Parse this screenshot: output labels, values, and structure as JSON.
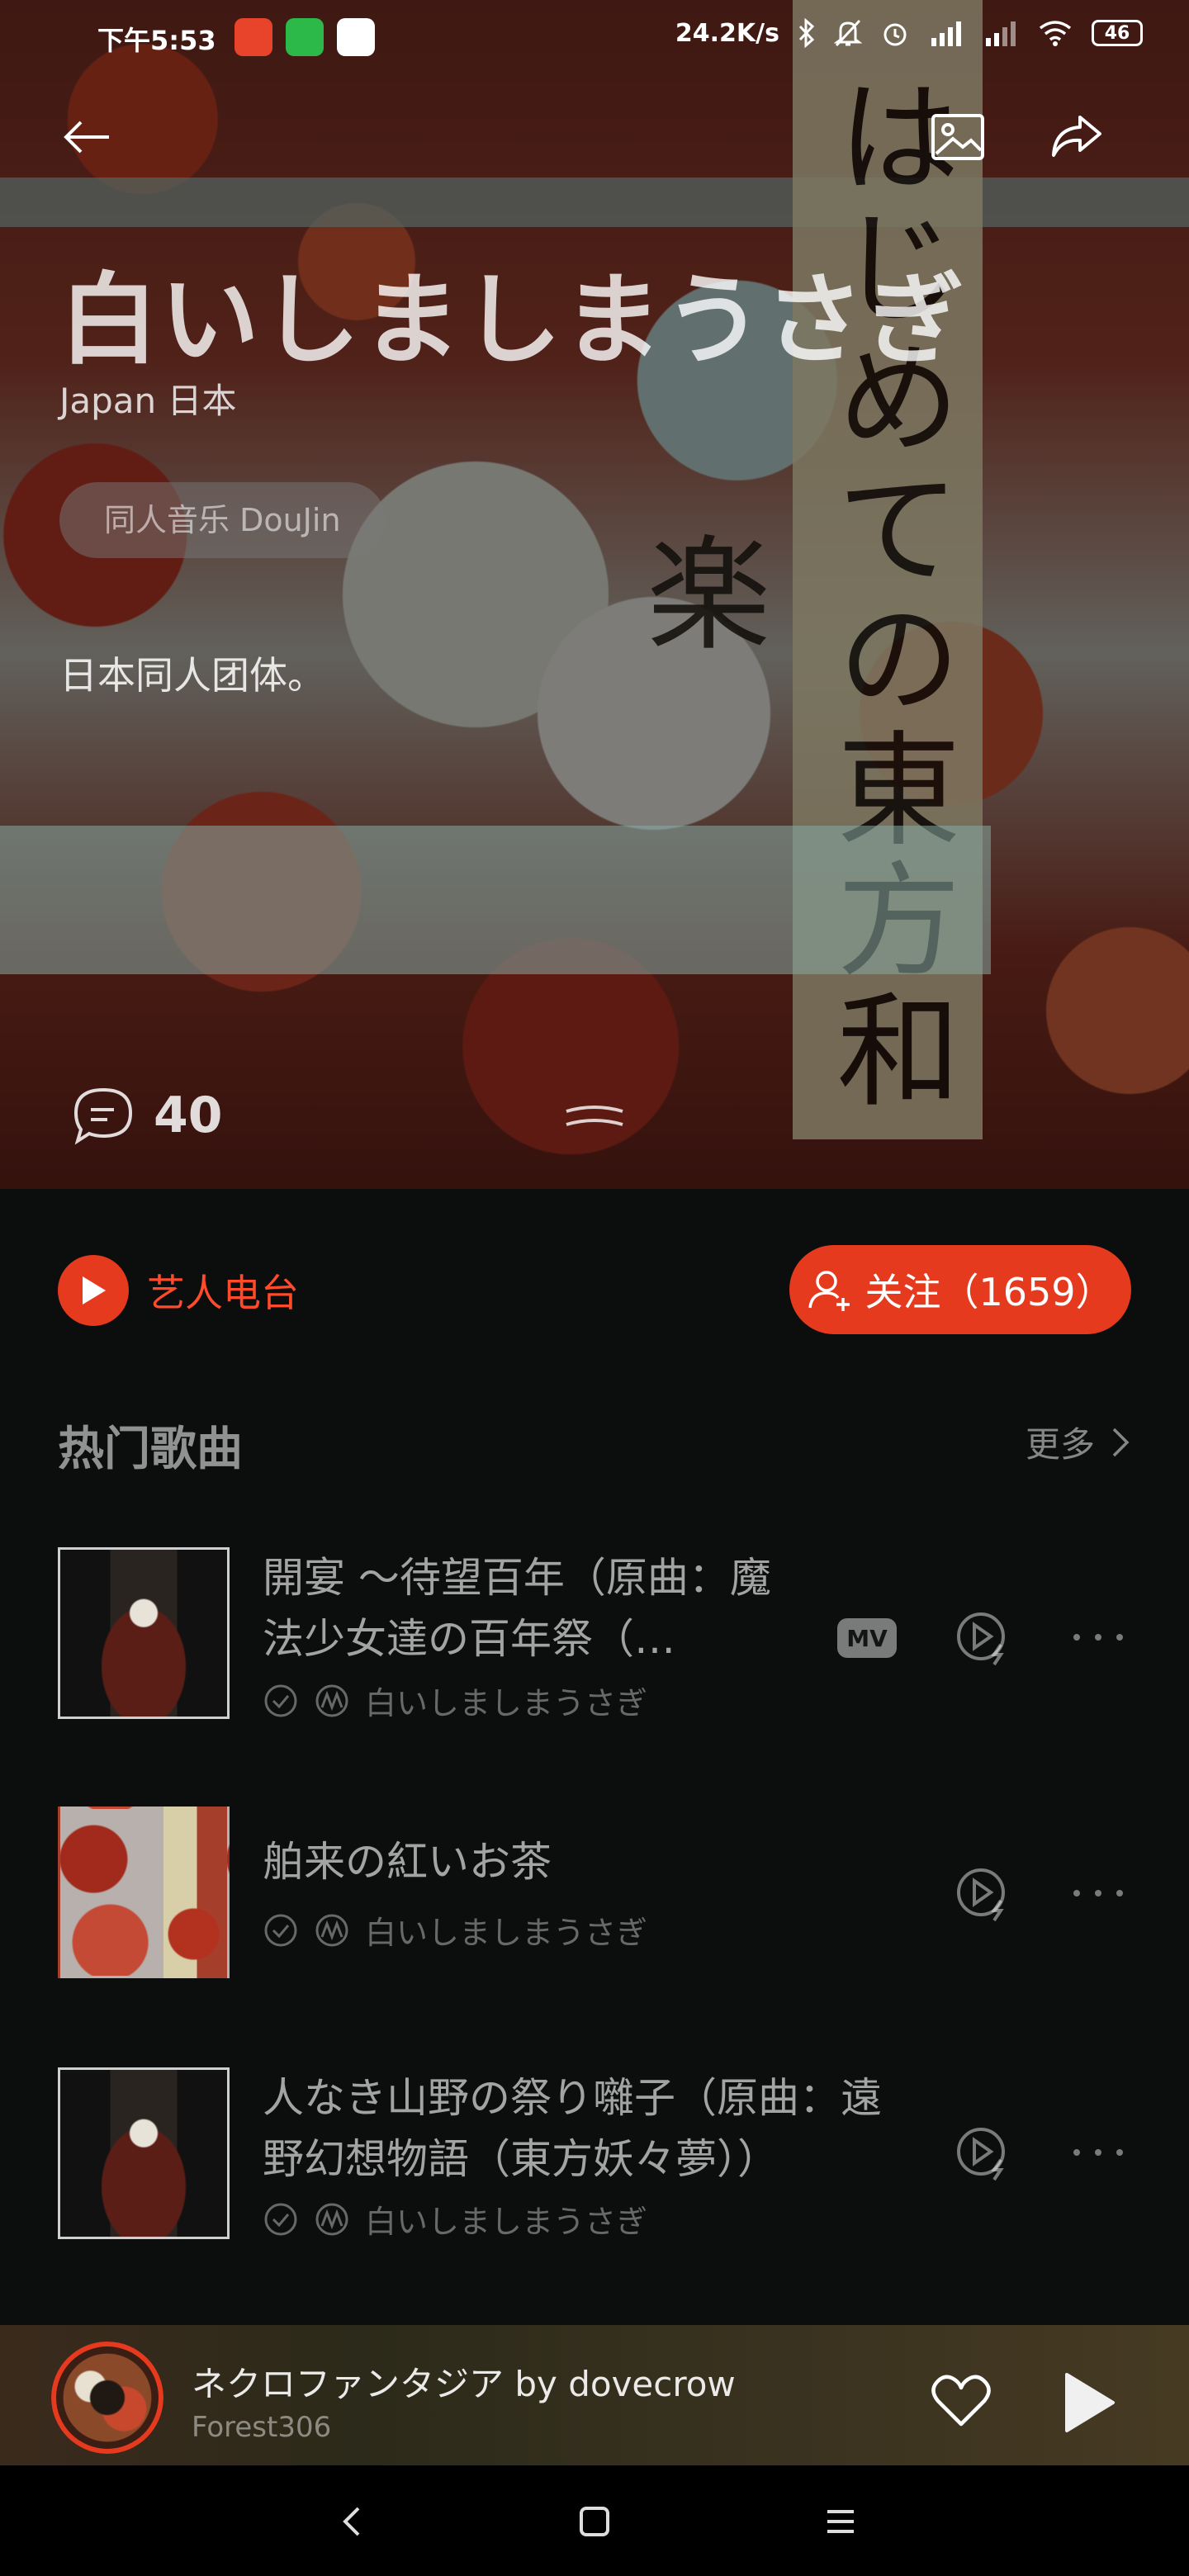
{
  "status_bar": {
    "time": "下午5:53",
    "network_speed": "24.2K/s",
    "battery": "46",
    "icons": [
      "app-icon-1",
      "wechat-icon",
      "qq-icon",
      "bluetooth-icon",
      "mute-icon",
      "alarm-icon",
      "signal-hd-icon",
      "signal-hd-icon",
      "wifi-icon",
      "battery-icon"
    ]
  },
  "nav": {
    "back_icon": "arrow-left-icon",
    "image_icon": "image-icon",
    "share_icon": "share-icon"
  },
  "artist": {
    "name": "白いしましまうさぎ",
    "country": "Japan 日本",
    "tag": "同人音乐 DouJin",
    "description": "日本同人团体。",
    "banner_text": "はじめての東方和楽",
    "comment_count": "40"
  },
  "actions": {
    "radio_label": "艺人电台",
    "follow_label": "关注（1659）"
  },
  "hot_songs": {
    "title": "热门歌曲",
    "more_label": "更多",
    "items": [
      {
        "title": "開宴 ～待望百年（原曲：魔法少女達の百年祭（…",
        "artist": "白いしましまうさぎ",
        "mv": "MV",
        "cover": "a"
      },
      {
        "title": "舶来の紅いお茶",
        "artist": "白いしましまうさぎ",
        "mv": "",
        "cover": "b"
      },
      {
        "title": "人なき山野の祭り囃子（原曲：遠野幻想物語（東方妖々夢））",
        "artist": "白いしましまうさぎ",
        "mv": "",
        "cover": "a"
      }
    ]
  },
  "mini_player": {
    "title": "ネクロファンタジア by dovecrow",
    "artist": "Forest306"
  },
  "colors": {
    "accent": "#e63a1e",
    "background": "#0b0e0d"
  }
}
